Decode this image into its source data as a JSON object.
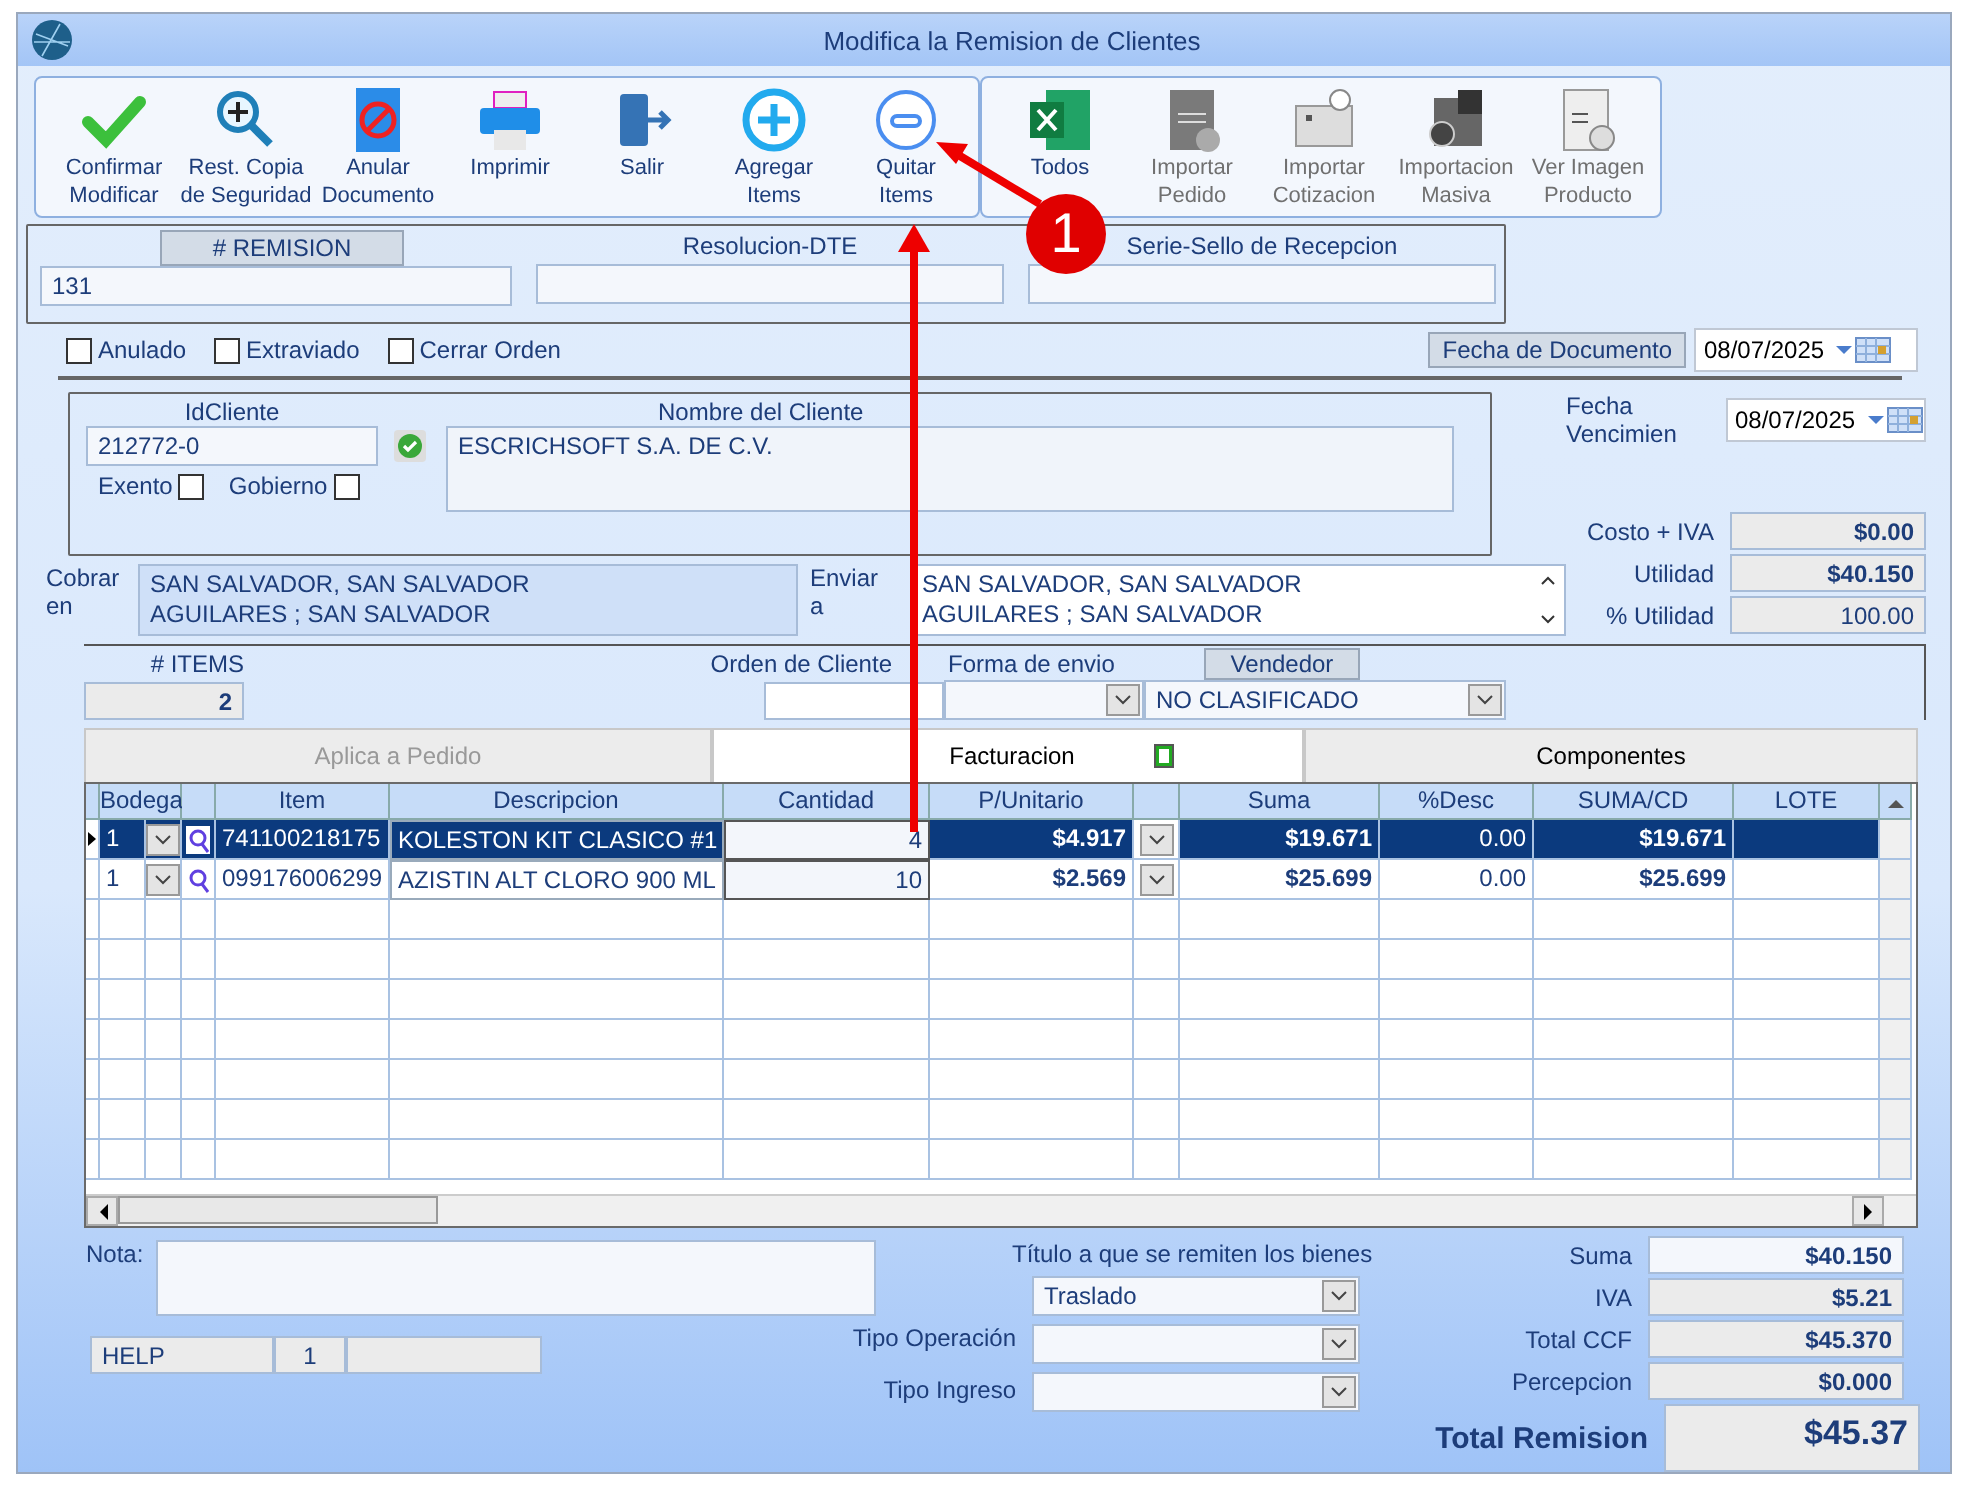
{
  "window": {
    "title": "Modifica la Remision de Clientes"
  },
  "toolbar_main": [
    {
      "label": "Confirmar\nModificar",
      "kind": "check",
      "disabled": false
    },
    {
      "label": "Rest. Copia\nde Seguridad",
      "kind": "magnifier",
      "disabled": false
    },
    {
      "label": "Anular\nDocumento",
      "kind": "void",
      "disabled": false
    },
    {
      "label": "Imprimir",
      "kind": "printer",
      "disabled": false
    },
    {
      "label": "Salir",
      "kind": "exit",
      "disabled": false
    },
    {
      "label": "Agregar\nItems",
      "kind": "plus",
      "disabled": false
    },
    {
      "label": "Quitar\nItems",
      "kind": "minus",
      "disabled": false
    }
  ],
  "toolbar_import": [
    {
      "label": "Todos",
      "kind": "excel",
      "disabled": false
    },
    {
      "label": "Importar\nPedido",
      "kind": "order",
      "disabled": true
    },
    {
      "label": "Importar\nCotizacion",
      "kind": "quote",
      "disabled": true
    },
    {
      "label": "Importacion\nMasiva",
      "kind": "bulk",
      "disabled": true
    },
    {
      "label": "Ver Imagen\nProducto",
      "kind": "invoice",
      "disabled": true
    }
  ],
  "header": {
    "remision_label": "# REMISION",
    "remision": "131",
    "resolucion_label": "Resolucion-DTE",
    "serie_label": "Serie-Sello de Recepcion"
  },
  "flags": [
    {
      "label": "Anulado",
      "checked": false
    },
    {
      "label": "Extraviado",
      "checked": false
    },
    {
      "label": "Cerrar Orden",
      "checked": false
    }
  ],
  "fecha_documento": {
    "label": "Fecha de  Documento",
    "value": "08/07/2025"
  },
  "cliente": {
    "id_label": "IdCliente",
    "id": "212772-0",
    "verified": true,
    "nombre_label": "Nombre del Cliente",
    "nombre": "ESCRICHSOFT S.A. DE C.V.",
    "options": [
      {
        "label": "Exento",
        "checked": false
      },
      {
        "label": "Gobierno",
        "checked": false
      }
    ]
  },
  "fecha_vencimiento": {
    "label": "Fecha Vencimien",
    "value": "08/07/2025"
  },
  "costs": [
    {
      "label": "Costo + IVA",
      "value": "$0.00",
      "bold": true
    },
    {
      "label": "Utilidad",
      "value": "$40.150",
      "bold": true
    },
    {
      "label": "% Utilidad",
      "value": "100.00",
      "bold": false
    }
  ],
  "addresses": [
    {
      "label": "Cobrar\nen",
      "lines": "SAN SALVADOR, SAN SALVADOR\nAGUILARES ; SAN SALVADOR",
      "scroll": false
    },
    {
      "label": "Enviar\na",
      "lines": "SAN SALVADOR, SAN SALVADOR\nAGUILARES ; SAN SALVADOR",
      "scroll": true
    }
  ],
  "items_bar": {
    "items_label": "# ITEMS",
    "items": "2",
    "orden_label": "Orden de Cliente",
    "forma_label": "Forma de envio",
    "vendedor_label": "Vendedor",
    "vendedor": "NO CLASIFICADO"
  },
  "tabs": [
    {
      "label": "Aplica a Pedido",
      "selected": false,
      "disabled": true
    },
    {
      "label": "Facturacion",
      "selected": true,
      "disabled": false
    },
    {
      "label": "Componentes",
      "selected": false,
      "disabled": false
    }
  ],
  "table": {
    "columns": [
      "Bodega",
      "Item",
      "Descripcion",
      "Cantidad",
      "P/Unitario",
      "Suma",
      "%Desc",
      "SUMA/CD",
      "LOTE"
    ],
    "rows": [
      {
        "bodega": "1",
        "item": "741100218175",
        "descripcion": "KOLESTON KIT CLASICO #1",
        "cantidad": "4",
        "unitario": "$4.917",
        "suma": "$19.671",
        "desc": "0.00",
        "suma_cd": "$19.671",
        "selected": true
      },
      {
        "bodega": "1",
        "item": "099176006299",
        "descripcion": "AZISTIN ALT CLORO 900 ML",
        "cantidad": "10",
        "unitario": "$2.569",
        "suma": "$25.699",
        "desc": "0.00",
        "suma_cd": "$25.699",
        "selected": false
      }
    ]
  },
  "bottom": {
    "nota_label": "Nota:",
    "help": [
      "HELP",
      "1"
    ],
    "titulo_label": "Título a que se remiten los bienes",
    "titulo": "Traslado",
    "tipo_operacion_label": "Tipo Operación",
    "tipo_ingreso_label": "Tipo Ingreso"
  },
  "totals": [
    {
      "label": "Suma",
      "value": "$40.150"
    },
    {
      "label": "IVA",
      "value": "$5.21"
    },
    {
      "label": "Total CCF",
      "value": "$45.370"
    },
    {
      "label": "Percepcion",
      "value": "$0.000"
    }
  ],
  "grand_total": {
    "label": "Total Remision",
    "value": "$45.37"
  },
  "annotation": {
    "number": "1"
  }
}
